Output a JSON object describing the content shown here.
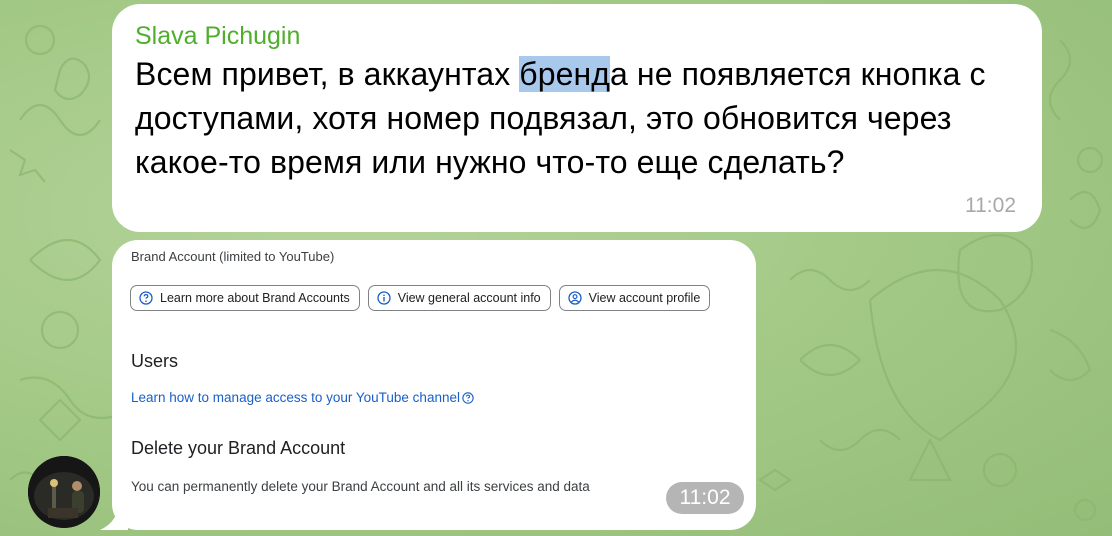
{
  "message1": {
    "sender": "Slava Pichugin",
    "text_before": "Всем привет, в аккаунтах ",
    "text_selected": "бренд",
    "text_after": "а не появляется кнопка с доступами, хотя номер подвязал, это обновится через какое-то время или нужно что-то еще сделать?",
    "time": "11:02"
  },
  "message2": {
    "screenshot": {
      "title": "Brand Account (limited to YouTube)",
      "buttons": [
        {
          "label": "Learn more about Brand Accounts",
          "icon": "help-circle-icon"
        },
        {
          "label": "View general account info",
          "icon": "info-icon"
        },
        {
          "label": "View account profile",
          "icon": "account-circle-icon"
        }
      ],
      "users_heading": "Users",
      "users_link": "Learn how to manage access to your YouTube channel",
      "delete_heading": "Delete your Brand Account",
      "delete_description": "You can permanently delete your Brand Account and all its services and data"
    },
    "time": "11:02"
  },
  "colors": {
    "sender_name": "#4fae2c",
    "selection": "#a8c8ec",
    "link": "#1a5fc8",
    "chat_background": "#a5ca88"
  }
}
